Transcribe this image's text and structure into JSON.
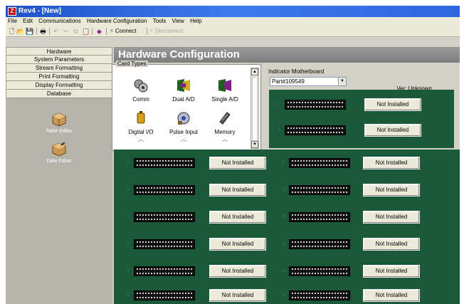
{
  "window": {
    "title": "Rev4 - [New]",
    "app_icon": "Z"
  },
  "menu": [
    "File",
    "Edit",
    "Communications",
    "Hardware Configuration",
    "Tools",
    "View",
    "Help"
  ],
  "toolbar": {
    "connect_label": "Connect",
    "disconnect_label": "Disconnect"
  },
  "sidebar": {
    "items": [
      "Hardware",
      "System Parameters",
      "Stream Formatting",
      "Print Formatting",
      "Display Formatting",
      "Database"
    ],
    "tools": [
      "Table Editor",
      "Data Editor"
    ]
  },
  "header": {
    "title": "Hardware Configuration"
  },
  "card_types": {
    "legend": "Card Types",
    "items": [
      "Comm",
      "Dual A/D",
      "Single A/D",
      "Digital I/O",
      "Pulse Input",
      "Memory"
    ]
  },
  "indicator": {
    "label": "Indicator Motherboard",
    "selected": "Part#109549",
    "version": "Ver: Unknown"
  },
  "slots": {
    "status_label": "Not Installed",
    "top_numbers": [
      "1",
      "2"
    ],
    "left_numbers": [
      "3",
      "4",
      "5",
      "6",
      "7",
      "8"
    ],
    "right_numbers": [
      "9",
      "10",
      "11",
      "12",
      "13",
      "14"
    ]
  },
  "colors": {
    "board_green": "#1a5a3a",
    "title_blue": "#2e66de",
    "header_gray": "#8a8a8a"
  }
}
